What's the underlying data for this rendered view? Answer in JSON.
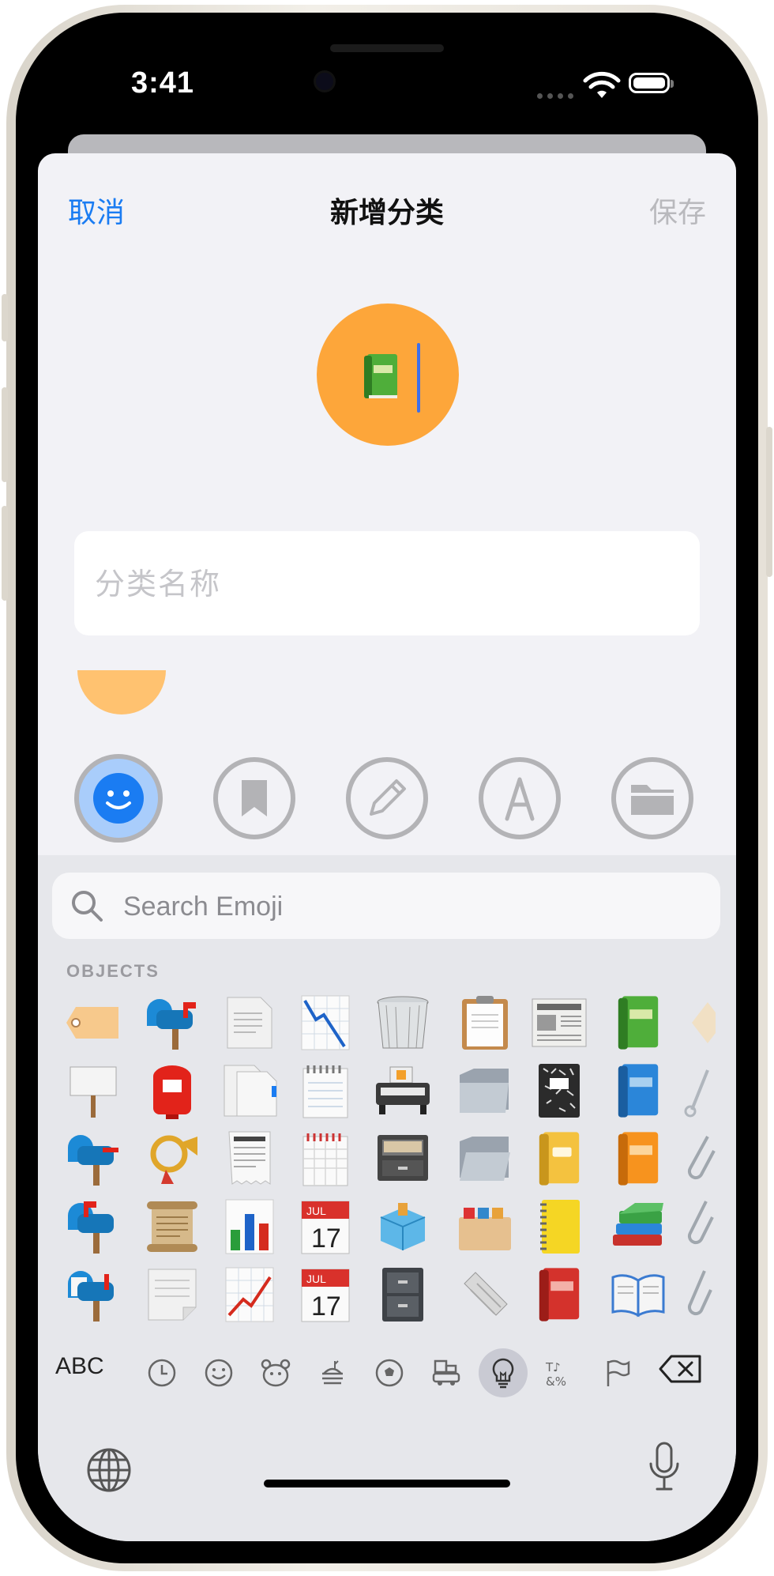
{
  "status_bar": {
    "time": "3:41"
  },
  "navigation": {
    "cancel_label": "取消",
    "title": "新增分类",
    "save_label": "保存"
  },
  "category_icon": {
    "emoji": "📗",
    "background_color": "#fda63a"
  },
  "name_field": {
    "placeholder": "分类名称",
    "value": ""
  },
  "color_option": {
    "color": "#ffc270"
  },
  "icon_choices": [
    {
      "name": "smiley",
      "selected": true
    },
    {
      "name": "bookmark",
      "selected": false
    },
    {
      "name": "pencil",
      "selected": false
    },
    {
      "name": "compass",
      "selected": false
    },
    {
      "name": "folder",
      "selected": false
    }
  ],
  "emoji_keyboard": {
    "search_placeholder": "Search Emoji",
    "section_label": "OBJECTS",
    "category_bar": {
      "abc_label": "ABC",
      "categories": [
        "recent",
        "smileys",
        "animals",
        "food",
        "activity",
        "travel",
        "objects",
        "symbols",
        "flags"
      ],
      "active": "objects"
    }
  }
}
